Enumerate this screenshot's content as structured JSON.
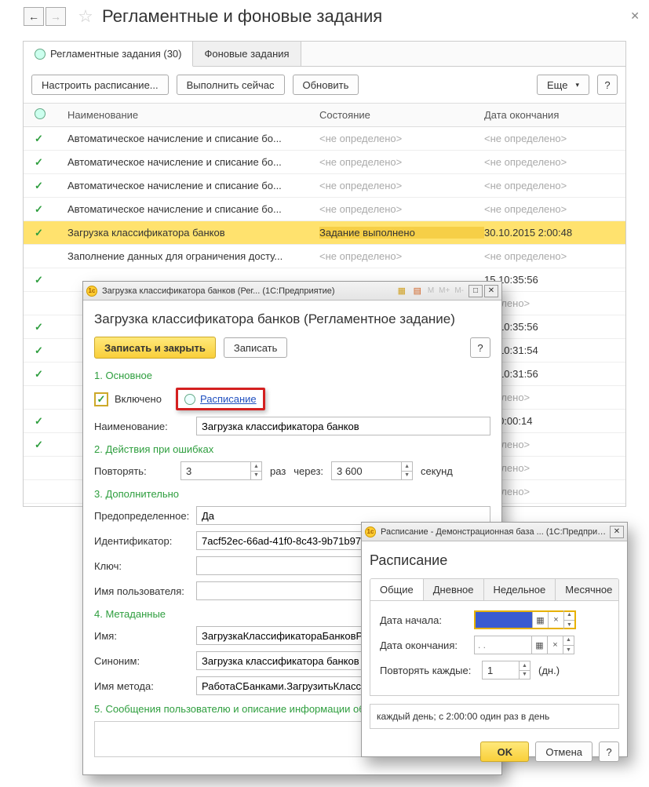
{
  "page_title": "Регламентные и фоновые задания",
  "tabs": {
    "t1": "Регламентные задания (30)",
    "t2": "Фоновые задания"
  },
  "toolbar": {
    "setup": "Настроить расписание...",
    "run": "Выполнить сейчас",
    "refresh": "Обновить",
    "more": "Еще",
    "help": "?"
  },
  "grid": {
    "headers": {
      "name": "Наименование",
      "state": "Состояние",
      "date": "Дата окончания"
    },
    "rows": [
      {
        "check": true,
        "name": "Автоматическое начисление и списание бо...",
        "state": "<не определено>",
        "date": "<не определено>",
        "muted": true
      },
      {
        "check": true,
        "name": "Автоматическое начисление и списание бо...",
        "state": "<не определено>",
        "date": "<не определено>",
        "muted": true
      },
      {
        "check": true,
        "name": "Автоматическое начисление и списание бо...",
        "state": "<не определено>",
        "date": "<не определено>",
        "muted": true
      },
      {
        "check": true,
        "name": "Автоматическое начисление и списание бо...",
        "state": "<не определено>",
        "date": "<не определено>",
        "muted": true
      },
      {
        "check": true,
        "name": "Загрузка классификатора банков",
        "state": "Задание выполнено",
        "date": "30.10.2015 2:00:48",
        "selected": true
      },
      {
        "check": false,
        "name": "Заполнение данных для ограничения досту...",
        "state": "<не определено>",
        "date": "<не определено>",
        "muted": true
      },
      {
        "check": true,
        "name": "",
        "state": "",
        "date": "15 10:35:56"
      },
      {
        "check": false,
        "name": "",
        "state": "",
        "date": "еделено>",
        "muted": true
      },
      {
        "check": true,
        "name": "",
        "state": "",
        "date": "15 10:35:56"
      },
      {
        "check": true,
        "name": "",
        "state": "",
        "date": "15 10:31:54"
      },
      {
        "check": true,
        "name": "",
        "state": "",
        "date": "15 10:31:56"
      },
      {
        "check": false,
        "name": "",
        "state": "",
        "date": "еделено>",
        "muted": true
      },
      {
        "check": true,
        "name": "",
        "state": "",
        "date": "15 0:00:14"
      },
      {
        "check": true,
        "name": "",
        "state": "",
        "date": "еделено>",
        "muted": true
      },
      {
        "check": false,
        "name": "",
        "state": "",
        "date": "еделено>",
        "muted": true
      },
      {
        "check": false,
        "name": "",
        "state": "",
        "date": "еделено>",
        "muted": true
      }
    ]
  },
  "dlg1": {
    "titlebar": "Загрузка классификатора банков (Рег...  (1С:Предприятие)",
    "title": "Загрузка классификатора банков (Регламентное задание)",
    "save_close": "Записать и закрыть",
    "save": "Записать",
    "help": "?",
    "sec1": "1. Основное",
    "enabled": "Включено",
    "schedule": "Расписание",
    "name_label": "Наименование:",
    "name_value": "Загрузка классификатора банков",
    "sec2": "2. Действия при ошибках",
    "repeat_label": "Повторять:",
    "repeat_val": "3",
    "times": "раз",
    "every": "через:",
    "interval_val": "3 600",
    "seconds": "секунд",
    "sec3": "3. Дополнительно",
    "pred_label": "Предопределенное:",
    "pred_val": "Да",
    "id_label": "Идентификатор:",
    "id_val": "7acf52ec-66ad-41f0-8c43-9b71b97f",
    "key_label": "Ключ:",
    "key_val": "",
    "user_label": "Имя пользователя:",
    "user_val": "",
    "sec4": "4. Метаданные",
    "mname_label": "Имя:",
    "mname_val": "ЗагрузкаКлассификатораБанковР",
    "syn_label": "Синоним:",
    "syn_val": "Загрузка классификатора банков",
    "method_label": "Имя метода:",
    "method_val": "РаботаСБанками.ЗагрузитьКласс",
    "sec5": "5. Сообщения пользователю и описание информации об"
  },
  "dlg2": {
    "titlebar": "Расписание - Демонстрационная база ...  (1С:Предприятие)",
    "title": "Расписание",
    "tabs": {
      "t1": "Общие",
      "t2": "Дневное",
      "t3": "Недельное",
      "t4": "Месячное"
    },
    "start_label": "Дата начала:",
    "start_val": "",
    "end_label": "Дата окончания:",
    "end_val": ".  .",
    "repeat_label": "Повторять каждые:",
    "repeat_val": "1",
    "repeat_unit": "(дн.)",
    "desc": "каждый  день; с 2:00:00 один раз в день",
    "ok": "OK",
    "cancel": "Отмена",
    "help": "?"
  }
}
